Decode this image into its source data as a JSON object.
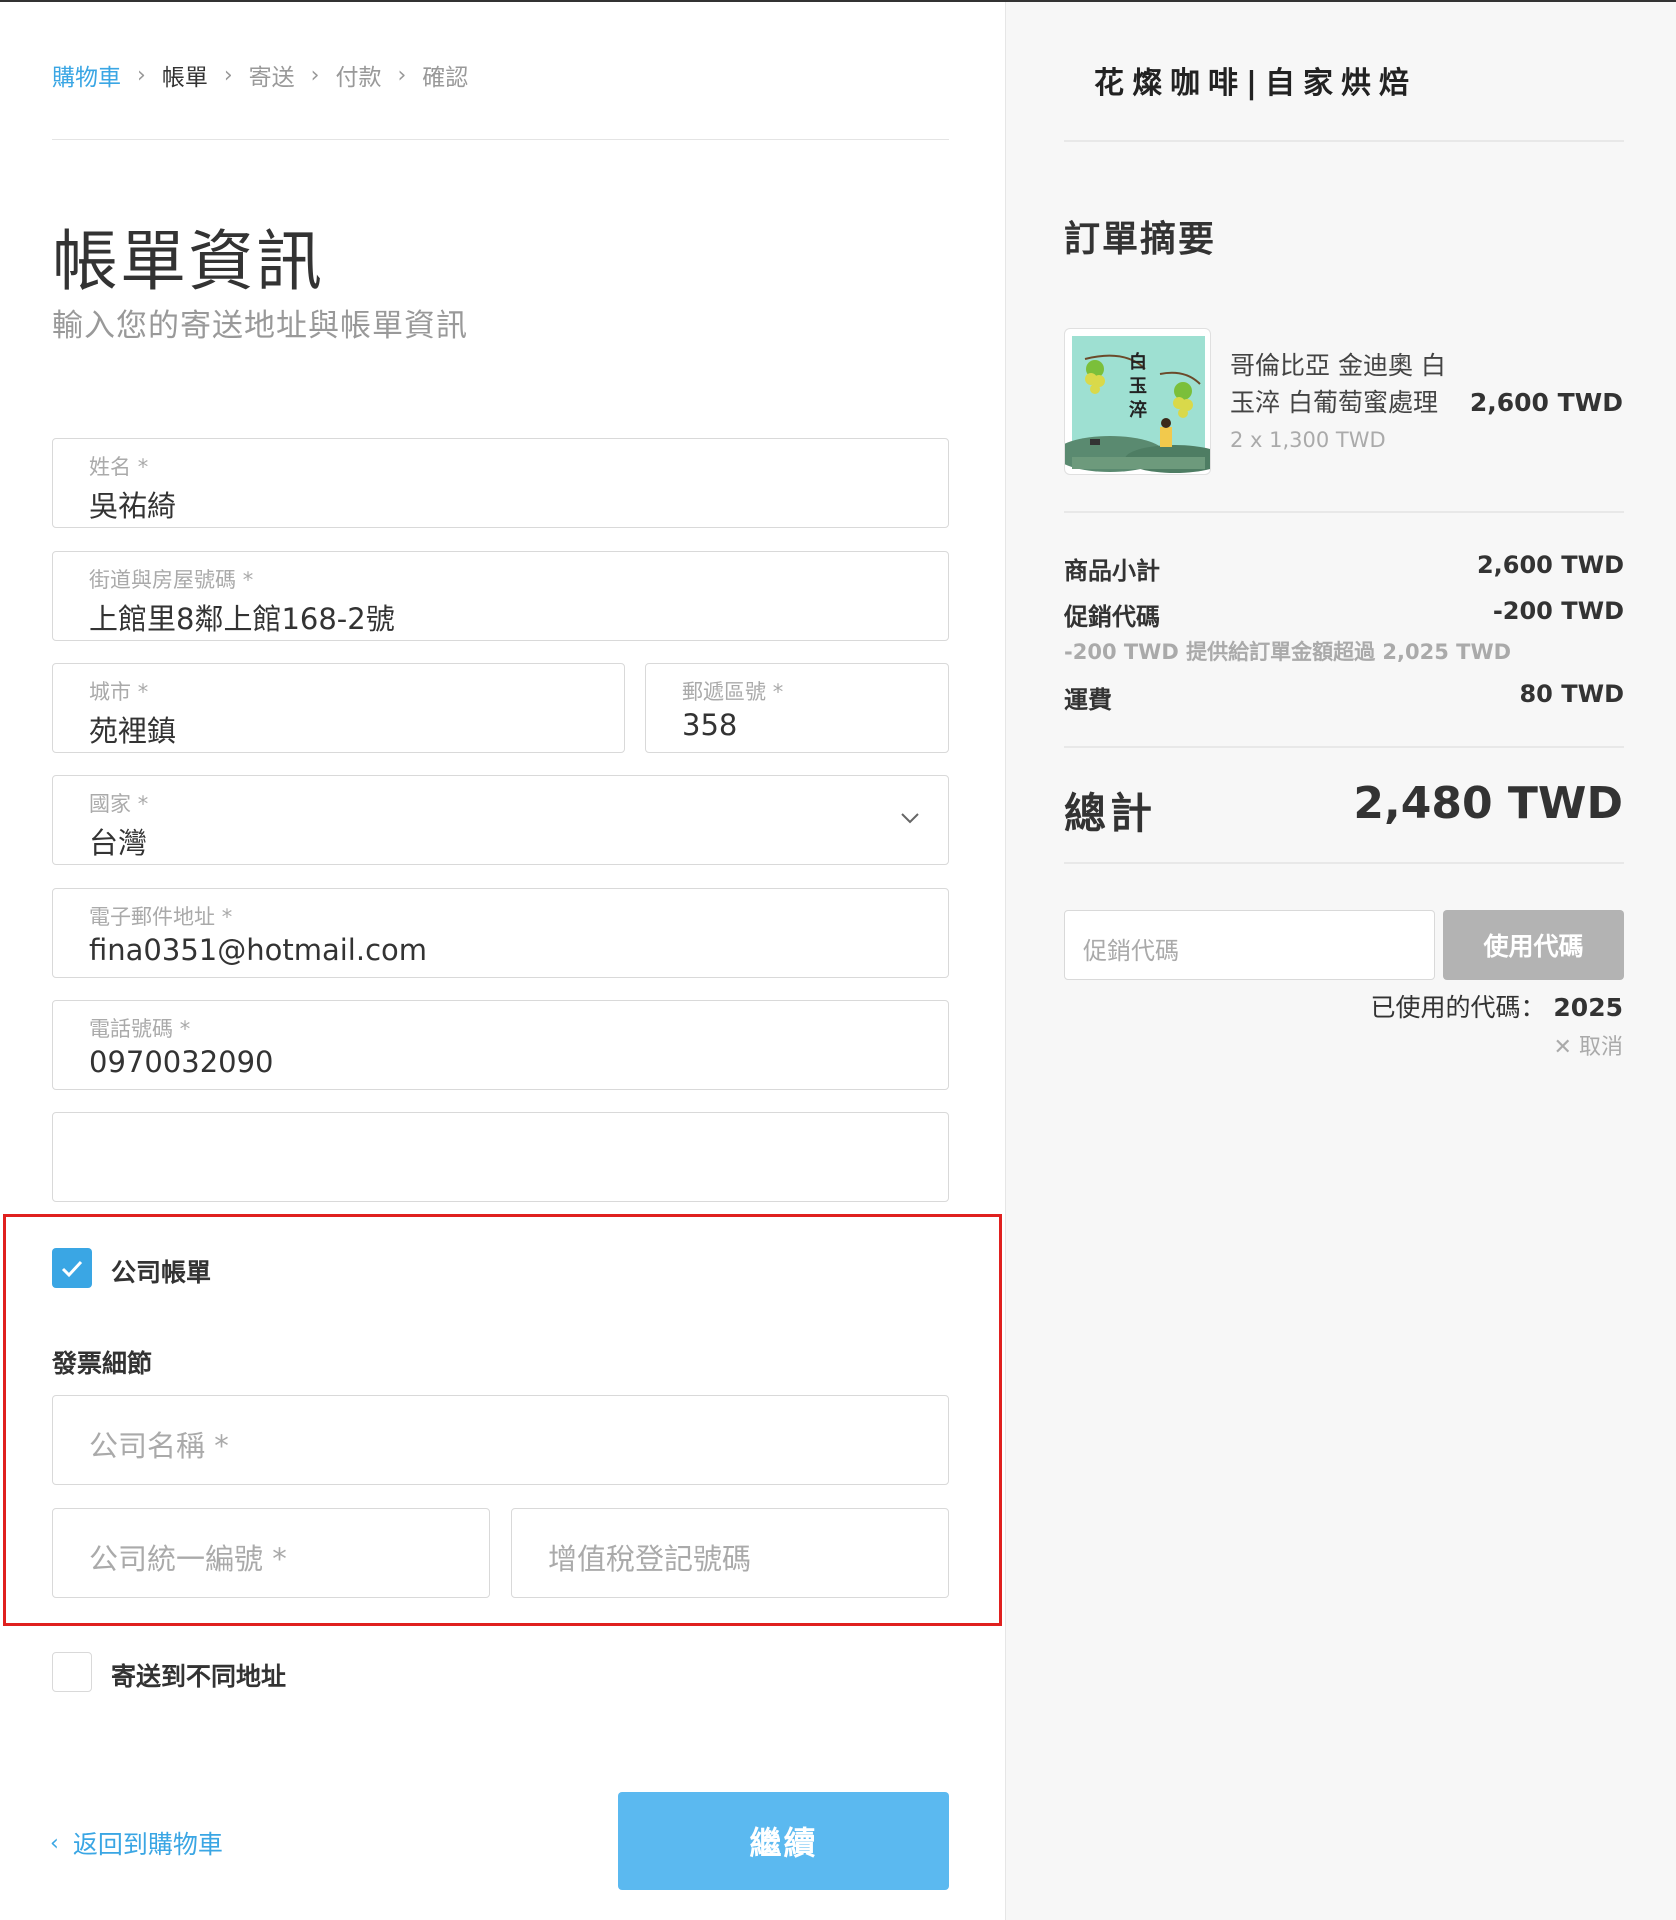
{
  "breadcrumb": {
    "items": [
      {
        "label": "購物車",
        "state": "link"
      },
      {
        "label": "帳單",
        "state": "current"
      },
      {
        "label": "寄送",
        "state": "upcoming"
      },
      {
        "label": "付款",
        "state": "upcoming"
      },
      {
        "label": "確認",
        "state": "upcoming"
      }
    ],
    "separator": "›"
  },
  "page": {
    "title": "帳單資訊",
    "subtitle": "輸入您的寄送地址與帳單資訊"
  },
  "form": {
    "name": {
      "label": "姓名",
      "required": "*",
      "value": "吳祐綺"
    },
    "street": {
      "label": "街道與房屋號碼",
      "required": "*",
      "value": "上館里8鄰上館168-2號"
    },
    "city": {
      "label": "城市",
      "required": "*",
      "value": "苑裡鎮"
    },
    "postal": {
      "label": "郵遞區號",
      "required": "*",
      "value": "358"
    },
    "country": {
      "label": "國家",
      "required": "*",
      "value": "台灣"
    },
    "email": {
      "label": "電子郵件地址",
      "required": "*",
      "value": "fina0351@hotmail.com"
    },
    "phone": {
      "label": "電話號碼",
      "required": "*",
      "value": "0970032090"
    },
    "extra": {
      "value": ""
    }
  },
  "company": {
    "checkbox_label": "公司帳單",
    "checked": true,
    "section_title": "發票細節",
    "company_name": {
      "placeholder": "公司名稱",
      "required": "*"
    },
    "tax_id": {
      "placeholder": "公司統一編號",
      "required": "*"
    },
    "vat": {
      "placeholder": "增值稅登記號碼"
    }
  },
  "ship_different": {
    "label": "寄送到不同地址",
    "checked": false
  },
  "nav": {
    "back_label": "返回到購物車",
    "back_icon": "‹",
    "continue_label": "繼續"
  },
  "summary": {
    "store_name": "花燦咖啡|自家烘焙",
    "title": "訂單摘要",
    "product": {
      "name": "哥倫比亞 金迪奧 白玉淬 白葡萄蜜處理",
      "qty": "2 x 1,300 TWD",
      "price": "2,600 TWD",
      "image_text": "白玉淬"
    },
    "subtotal": {
      "label": "商品小計",
      "value": "2,600 TWD"
    },
    "promo": {
      "label": "促銷代碼",
      "value": "-200 TWD",
      "note": "-200 TWD 提供給訂單金額超過 2,025 TWD"
    },
    "shipping": {
      "label": "運費",
      "value": "80 TWD"
    },
    "total": {
      "label": "總計",
      "value": "2,480 TWD"
    },
    "promo_input": {
      "placeholder": "促銷代碼"
    },
    "promo_button": "使用代碼",
    "used_code": {
      "label": "已使用的代碼：",
      "code": "2025"
    },
    "cancel": {
      "icon": "✕",
      "label": "取消"
    }
  },
  "colors": {
    "accent": "#3aa6e4",
    "continue_button": "#5bb9f0",
    "promo_button": "#b3b3b3",
    "highlight_box": "#e0201f"
  }
}
